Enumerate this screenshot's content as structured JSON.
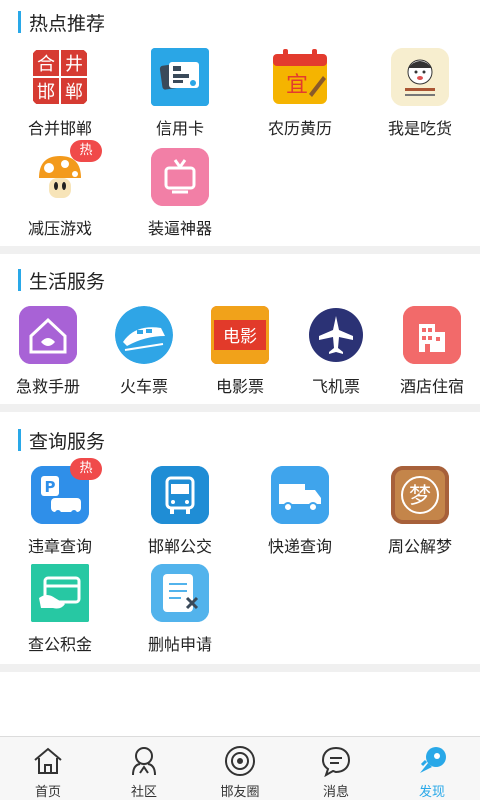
{
  "sections": {
    "hot": {
      "title": "热点推荐",
      "items": [
        {
          "label": "合并邯郸",
          "icon": "merge-handan-icon",
          "badge": ""
        },
        {
          "label": "信用卡",
          "icon": "credit-card-icon",
          "badge": ""
        },
        {
          "label": "农历黄历",
          "icon": "almanac-icon",
          "badge": ""
        },
        {
          "label": "我是吃货",
          "icon": "foodie-icon",
          "badge": ""
        },
        {
          "label": "减压游戏",
          "icon": "mushroom-game-icon",
          "badge": "热"
        },
        {
          "label": "装逼神器",
          "icon": "tv-icon",
          "badge": ""
        }
      ]
    },
    "life": {
      "title": "生活服务",
      "items": [
        {
          "label": "急救手册",
          "icon": "first-aid-icon"
        },
        {
          "label": "火车票",
          "icon": "train-icon"
        },
        {
          "label": "电影票",
          "icon": "movie-icon"
        },
        {
          "label": "飞机票",
          "icon": "airplane-icon"
        },
        {
          "label": "酒店住宿",
          "icon": "hotel-icon"
        }
      ]
    },
    "query": {
      "title": "查询服务",
      "items": [
        {
          "label": "违章查询",
          "icon": "parking-car-icon",
          "badge": "热"
        },
        {
          "label": "邯郸公交",
          "icon": "bus-icon",
          "badge": ""
        },
        {
          "label": "快递查询",
          "icon": "truck-icon",
          "badge": ""
        },
        {
          "label": "周公解梦",
          "icon": "dream-icon",
          "badge": ""
        },
        {
          "label": "查公积金",
          "icon": "fund-card-icon",
          "badge": ""
        },
        {
          "label": "删帖申请",
          "icon": "delete-post-icon",
          "badge": ""
        }
      ]
    }
  },
  "icon_text": {
    "merge": [
      "合",
      "井",
      "邯",
      "郸"
    ],
    "almanac": "宜",
    "movie": "电影",
    "dream": "梦",
    "parking": "P"
  },
  "tabbar": {
    "items": [
      {
        "label": "首页",
        "icon": "home-icon"
      },
      {
        "label": "社区",
        "icon": "community-icon"
      },
      {
        "label": "邯友圈",
        "icon": "friends-circle-icon"
      },
      {
        "label": "消息",
        "icon": "message-icon"
      },
      {
        "label": "发现",
        "icon": "discover-rocket-icon"
      }
    ],
    "active": "发现"
  },
  "colors": {
    "accent": "#29a8e8",
    "badge": "#f04a4a",
    "divider": "#f0f0f0"
  }
}
